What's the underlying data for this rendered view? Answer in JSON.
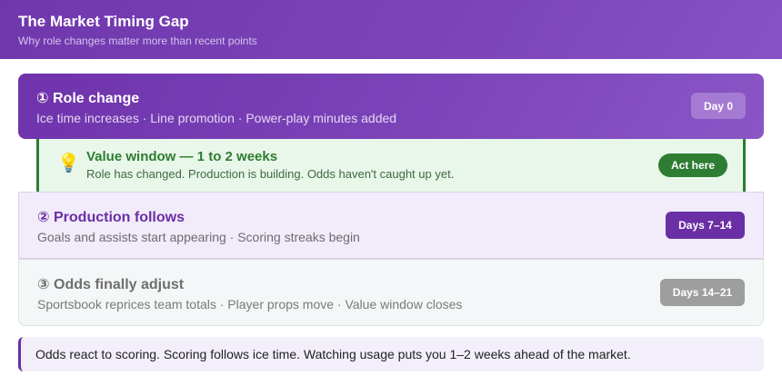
{
  "header": {
    "title": "The Market Timing Gap",
    "subtitle": "Why role changes matter more than recent points"
  },
  "steps": [
    {
      "title": "① Role change",
      "description": "Ice time increases · Line promotion · Power-play minutes added",
      "badge": "Day 0"
    },
    {
      "title": "② Production follows",
      "description": "Goals and assists start appearing · Scoring streaks begin",
      "badge": "Days 7–14"
    },
    {
      "title": "③ Odds finally adjust",
      "description": "Sportsbook reprices team totals · Player props move · Value window closes",
      "badge": "Days 14–21"
    }
  ],
  "value_window": {
    "icon": "lightbulb-icon",
    "icon_glyph": "💡",
    "title": "Value window — 1 to 2 weeks",
    "description": "Role has changed. Production is building. Odds haven't caught up yet.",
    "action_label": "Act here"
  },
  "note": {
    "text": "Odds react to scoring. Scoring follows ice time. Watching usage puts you 1–2 weeks ahead of the market."
  },
  "colors": {
    "primary_purple": "#6a2ea5",
    "value_green": "#2e7d32",
    "closed_gray": "#9e9e9e"
  }
}
